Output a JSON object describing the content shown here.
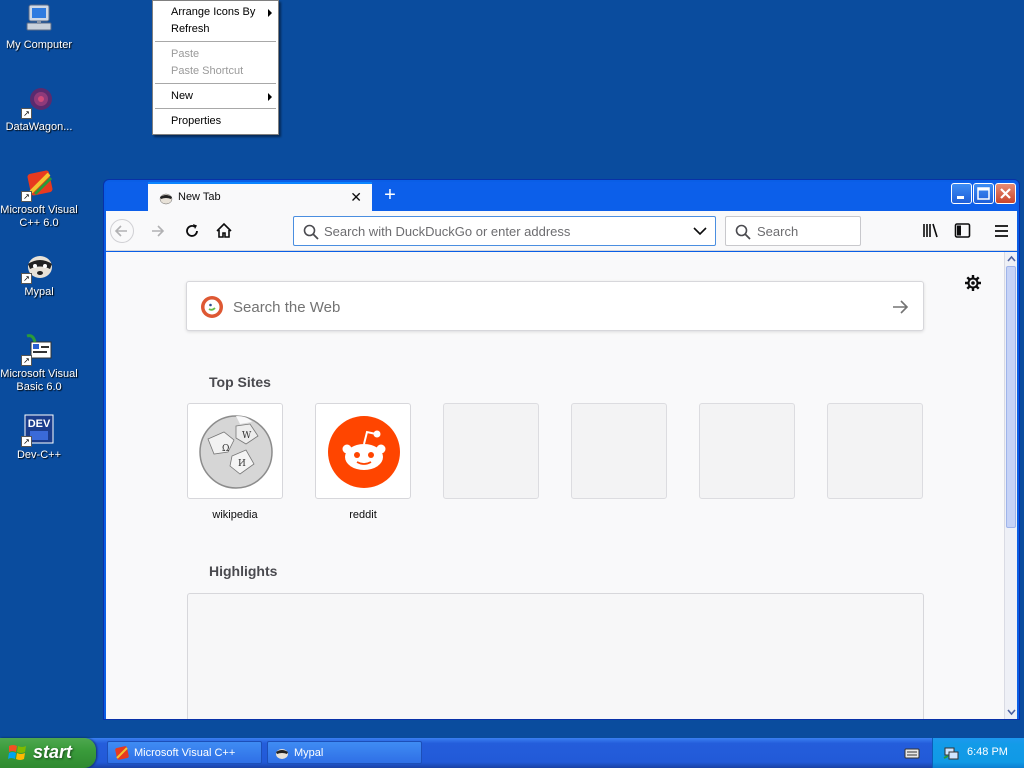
{
  "desktop": {
    "background_color": "#0a4c9e",
    "icons": [
      {
        "label": "My Computer",
        "icon": "my-computer-icon"
      },
      {
        "label": "DataWagon...",
        "icon": "datawagon-icon"
      },
      {
        "label": "Microsoft Visual C++ 6.0",
        "icon": "visual-cpp-icon"
      },
      {
        "label": "Mypal",
        "icon": "mypal-icon"
      },
      {
        "label": "Microsoft Visual Basic 6.0",
        "icon": "visual-basic-icon"
      },
      {
        "label": "Dev-C++",
        "icon": "dev-cpp-icon"
      }
    ]
  },
  "context_menu": {
    "items": [
      {
        "label": "Arrange Icons By",
        "enabled": true,
        "submenu": true
      },
      {
        "label": "Refresh",
        "enabled": true,
        "submenu": false
      },
      {
        "label": "Paste",
        "enabled": false,
        "submenu": false
      },
      {
        "label": "Paste Shortcut",
        "enabled": false,
        "submenu": false
      },
      {
        "label": "New",
        "enabled": true,
        "submenu": true
      },
      {
        "label": "Properties",
        "enabled": true,
        "submenu": false
      }
    ]
  },
  "browser": {
    "tab": {
      "title": "New Tab"
    },
    "urlbar": {
      "placeholder": "Search with DuckDuckGo or enter address",
      "value": ""
    },
    "searchbar": {
      "placeholder": "Search"
    },
    "content": {
      "web_search_placeholder": "Search the Web",
      "top_sites_title": "Top Sites",
      "top_sites": [
        {
          "label": "wikipedia",
          "icon": "wikipedia-icon"
        },
        {
          "label": "reddit",
          "icon": "reddit-icon"
        },
        {
          "label": "",
          "icon": ""
        },
        {
          "label": "",
          "icon": ""
        },
        {
          "label": "",
          "icon": ""
        },
        {
          "label": "",
          "icon": ""
        }
      ],
      "highlights_title": "Highlights"
    },
    "colors": {
      "titlebar": "#0c5fea",
      "accent": "#0a84ff",
      "reddit": "#ff4500"
    }
  },
  "taskbar": {
    "start_label": "start",
    "buttons": [
      {
        "label": "Microsoft Visual C++",
        "icon": "visual-cpp-icon"
      },
      {
        "label": "Mypal",
        "icon": "mypal-icon"
      }
    ],
    "clock": "6:48 PM"
  }
}
